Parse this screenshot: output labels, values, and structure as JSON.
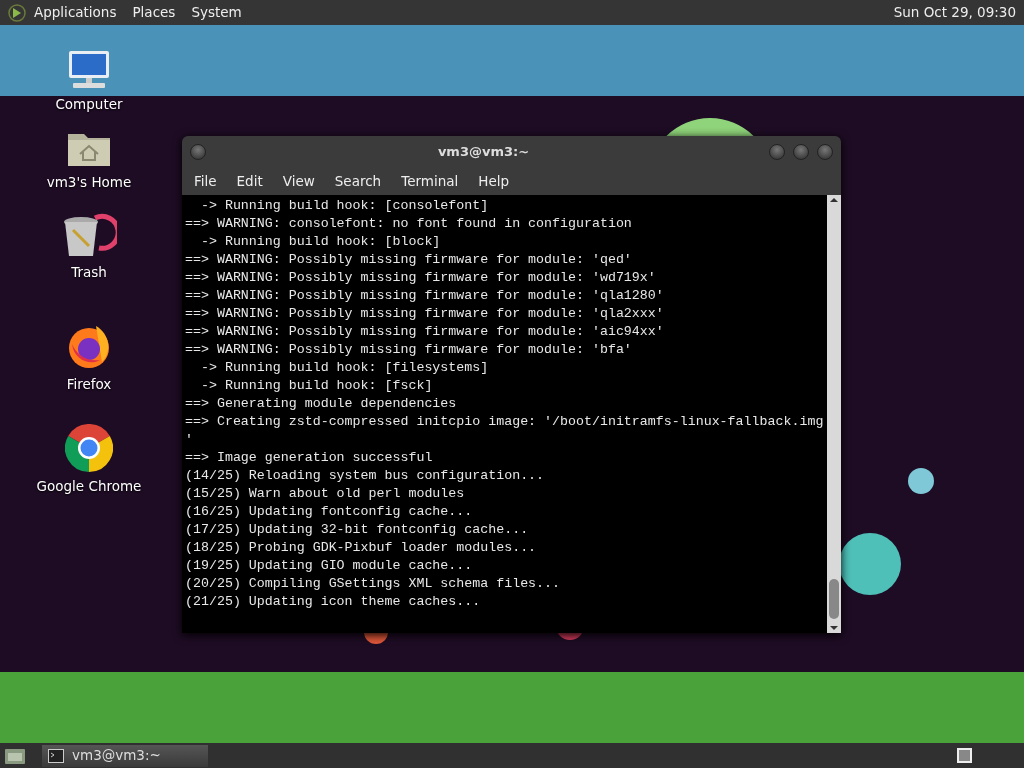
{
  "top_panel": {
    "menus": [
      "Applications",
      "Places",
      "System"
    ],
    "clock": "Sun Oct 29, 09:30"
  },
  "desktop_icons": [
    {
      "kind": "computer",
      "label": "Computer"
    },
    {
      "kind": "home",
      "label": "vm3's Home"
    },
    {
      "kind": "trash",
      "label": "Trash"
    },
    {
      "kind": "firefox",
      "label": "Firefox"
    },
    {
      "kind": "chrome",
      "label": "Google Chrome"
    }
  ],
  "terminal": {
    "title": "vm3@vm3:~",
    "menu": [
      "File",
      "Edit",
      "View",
      "Search",
      "Terminal",
      "Help"
    ],
    "lines": [
      "  -> Running build hook: [consolefont]",
      "==> WARNING: consolefont: no font found in configuration",
      "  -> Running build hook: [block]",
      "==> WARNING: Possibly missing firmware for module: 'qed'",
      "==> WARNING: Possibly missing firmware for module: 'wd719x'",
      "==> WARNING: Possibly missing firmware for module: 'qla1280'",
      "==> WARNING: Possibly missing firmware for module: 'qla2xxx'",
      "==> WARNING: Possibly missing firmware for module: 'aic94xx'",
      "==> WARNING: Possibly missing firmware for module: 'bfa'",
      "  -> Running build hook: [filesystems]",
      "  -> Running build hook: [fsck]",
      "==> Generating module dependencies",
      "==> Creating zstd-compressed initcpio image: '/boot/initramfs-linux-fallback.img",
      "'",
      "==> Image generation successful",
      "(14/25) Reloading system bus configuration...",
      "(15/25) Warn about old perl modules",
      "(16/25) Updating fontconfig cache...",
      "(17/25) Updating 32-bit fontconfig cache...",
      "(18/25) Probing GDK-Pixbuf loader modules...",
      "(19/25) Updating GIO module cache...",
      "(20/25) Compiling GSettings XML schema files...",
      "(21/25) Updating icon theme caches..."
    ]
  },
  "taskbar": {
    "tasks": [
      {
        "label": "vm3@vm3:~",
        "selected": true
      }
    ]
  }
}
